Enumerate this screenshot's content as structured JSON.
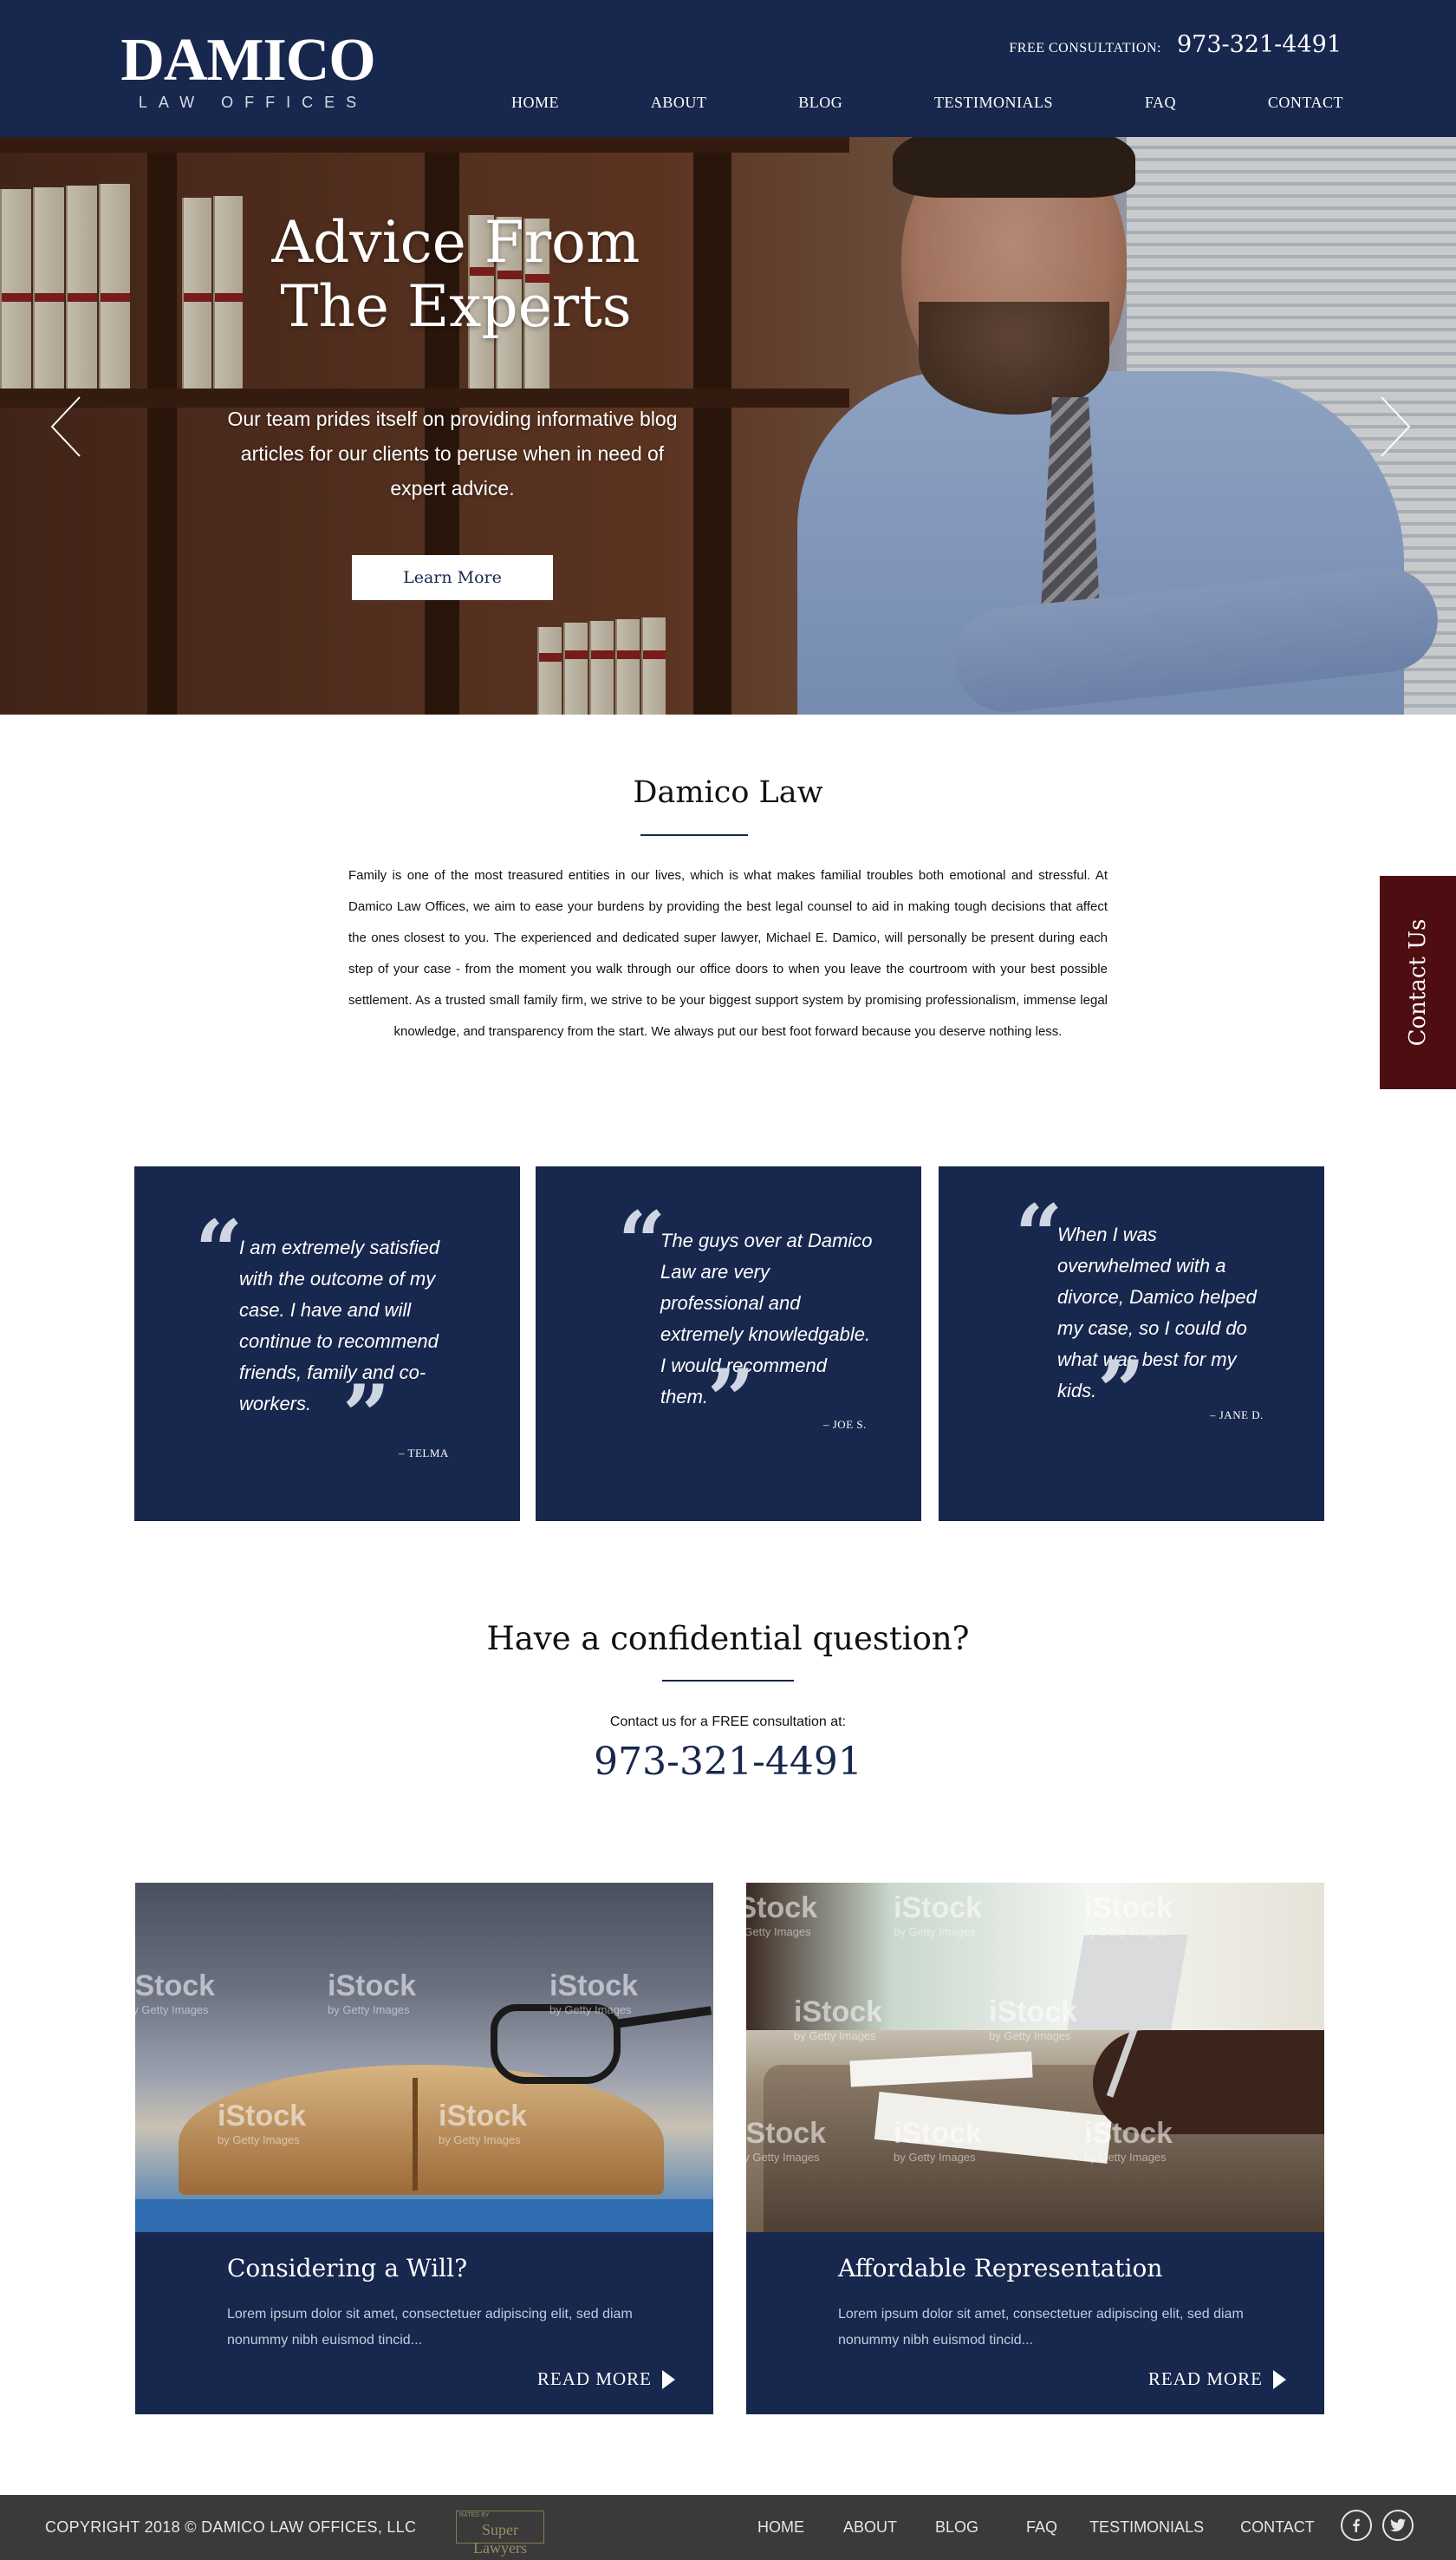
{
  "header": {
    "logo_main": "DAMICO",
    "logo_sub": "LAW OFFICES",
    "consultation_label": "FREE CONSULTATION:",
    "consultation_phone": "973-321-4491",
    "nav": [
      "HOME",
      "ABOUT",
      "BLOG",
      "TESTIMONIALS",
      "FAQ",
      "CONTACT"
    ]
  },
  "hero": {
    "title_line1": "Advice From",
    "title_line2": "The Experts",
    "text": "Our team prides itself on providing informative blog articles for our clients to peruse when in need of expert advice.",
    "button": "Learn More",
    "prev_icon": "chevron-left-icon",
    "next_icon": "chevron-right-icon"
  },
  "contact_tab": "Contact Us",
  "about": {
    "title": "Damico Law",
    "text": "Family is one of the most treasured entities in our lives, which is what makes familial troubles both emotional and stressful. At Damico Law Offices, we aim to ease your burdens by providing the best legal counsel to aid in making tough decisions that affect the ones closest to you. The experienced and dedicated super lawyer, Michael E. Damico, will personally be present during each step of your case - from the moment you walk through our office doors to when you leave the courtroom with your best possible settlement. As a trusted small family firm, we strive to be your biggest support system by promising professionalism, immense legal knowledge, and transparency from the start. We always put our best foot forward because you deserve nothing less."
  },
  "testimonials": [
    {
      "quote": "I am extremely satisfied with the outcome of my case. I have and will continue to recommend friends, family and co-workers.",
      "author": "– TELMA"
    },
    {
      "quote": "The guys over at Damico Law are very professional and extremely knowledgable. I would recommend them.",
      "author": "– JOE S."
    },
    {
      "quote": "When I was overwhelmed with a divorce, Damico helped my case, so I could do what was best for my kids.",
      "author": "– JANE D."
    }
  ],
  "confidential": {
    "title": "Have a confidential question?",
    "subtitle": "Contact us for a FREE consultation at:",
    "phone": "973-321-4491"
  },
  "articles": [
    {
      "title": "Considering a Will?",
      "text": "Lorem ipsum dolor sit amet, consectetuer adipiscing elit, sed diam nonummy nibh euismod tincid...",
      "read_more": "READ MORE"
    },
    {
      "title": "Affordable Representation",
      "text": "Lorem ipsum dolor sit amet, consectetuer adipiscing elit, sed diam nonummy nibh euismod tincid...",
      "read_more": "READ MORE"
    }
  ],
  "watermark": {
    "brand": "iStock",
    "sub": "by Getty Images"
  },
  "footer": {
    "copyright": "COPYRIGHT 2018 © DAMICO LAW OFFICES, LLC",
    "badge_rated": "RATED BY",
    "badge_name": "Super Lawyers",
    "nav": [
      "HOME",
      "ABOUT",
      "BLOG",
      "FAQ",
      "TESTIMONIALS",
      "CONTACT"
    ],
    "social": [
      "facebook-icon",
      "twitter-icon"
    ]
  },
  "colors": {
    "navy": "#17274d",
    "maroon": "#4e0d10",
    "footer": "#3a3a3a"
  }
}
